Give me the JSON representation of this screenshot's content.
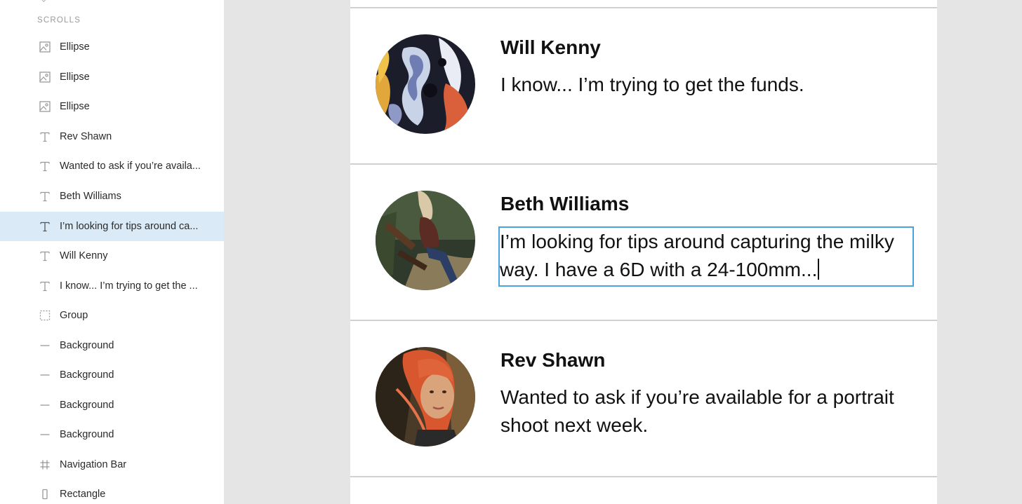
{
  "layers_panel": {
    "section_title": "SCROLLS",
    "items": [
      {
        "label": "Ellipse",
        "icon": "image-icon"
      },
      {
        "label": "Ellipse",
        "icon": "image-icon"
      },
      {
        "label": "Ellipse",
        "icon": "image-icon"
      },
      {
        "label": "Rev Shawn",
        "icon": "text-icon"
      },
      {
        "label": "Wanted to ask if you’re availa...",
        "icon": "text-icon"
      },
      {
        "label": "Beth Williams",
        "icon": "text-icon"
      },
      {
        "label": "I’m looking for tips around ca...",
        "icon": "text-icon",
        "selected": true
      },
      {
        "label": "Will Kenny",
        "icon": "text-icon"
      },
      {
        "label": "I know... I’m trying to get the ...",
        "icon": "text-icon"
      },
      {
        "label": "Group",
        "icon": "group-icon"
      },
      {
        "label": "Background",
        "icon": "line-icon"
      },
      {
        "label": "Background",
        "icon": "line-icon"
      },
      {
        "label": "Background",
        "icon": "line-icon"
      },
      {
        "label": "Background",
        "icon": "line-icon"
      },
      {
        "label": "Navigation Bar",
        "icon": "frame-icon"
      },
      {
        "label": "Rectangle",
        "icon": "rectangle-icon"
      }
    ]
  },
  "artboard": {
    "messages": [
      {
        "name": "Will Kenny",
        "text": "I know... I’m trying to get the funds."
      },
      {
        "name": "Beth Williams",
        "text": "I’m looking for tips around capturing the milky way. I have a 6D with a 24-100mm...",
        "editing": true
      },
      {
        "name": "Rev Shawn",
        "text": "Wanted to ask if you’re available for a portrait shoot next week."
      }
    ]
  },
  "colors": {
    "canvas_bg": "#e5e5e5",
    "selection_bg": "#daebf7",
    "edit_outline": "#4aa3df"
  }
}
